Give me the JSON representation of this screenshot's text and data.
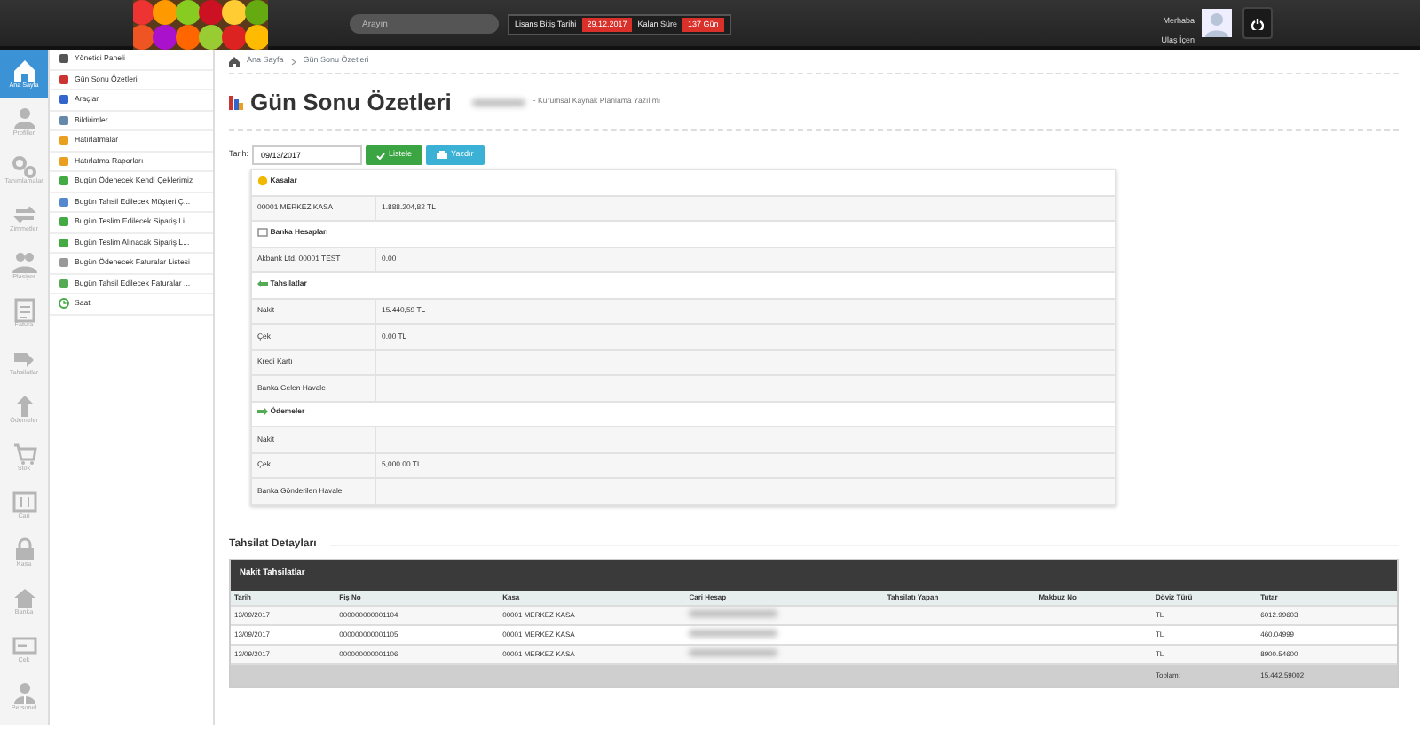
{
  "topbar": {
    "search": {
      "placeholder": "Arayın"
    },
    "license": {
      "label": "Lisans Bitiş Tarihi",
      "date": "29.12.2017",
      "remaining_label": "Kalan Süre",
      "remaining": "137 Gün"
    },
    "user": {
      "greeting": "Merhaba",
      "name": "Ulaş İçen"
    }
  },
  "icon_nav": [
    {
      "label": "Ana Sayfa",
      "selected": true
    },
    {
      "label": "Profiller",
      "selected": false
    },
    {
      "label": "Tanımlamalar",
      "selected": false
    },
    {
      "label": "Zimmetler",
      "selected": false
    },
    {
      "label": "Plasiyer",
      "selected": false
    },
    {
      "label": "Fatura",
      "selected": false
    },
    {
      "label": "Tahsilatlar",
      "selected": false
    },
    {
      "label": "Ödemeler",
      "selected": false
    },
    {
      "label": "Stok",
      "selected": false
    },
    {
      "label": "Cari",
      "selected": false
    },
    {
      "label": "Kasa",
      "selected": false
    },
    {
      "label": "Banka",
      "selected": false
    },
    {
      "label": "Çek",
      "selected": false
    },
    {
      "label": "Personel",
      "selected": false
    }
  ],
  "menu": [
    {
      "label": "Yönetici Paneli"
    },
    {
      "label": "Gün Sonu Özetleri"
    },
    {
      "label": "Araçlar"
    },
    {
      "label": "Bildirimler"
    },
    {
      "label": "Hatırlatmalar"
    },
    {
      "label": "Hatırlatma Raporları"
    },
    {
      "label": "Bugün Ödenecek Kendi Çeklerimiz"
    },
    {
      "label": "Bugün Tahsil Edilecek Müşteri Ç..."
    },
    {
      "label": "Bugün Teslim Edilecek Sipariş Li..."
    },
    {
      "label": "Bugün Teslim Alınacak Sipariş L..."
    },
    {
      "label": "Bugün Ödenecek Faturalar Listesi"
    },
    {
      "label": "Bugün Tahsil Edilecek Faturalar ..."
    },
    {
      "label": "Saat"
    }
  ],
  "breadcrumb": [
    "Ana Sayfa",
    "Gün Sonu Özetleri"
  ],
  "page_title": "Gün Sonu Özetleri",
  "subtitle": "- Kurumsal Kaynak Planlama Yazılımı",
  "filter": {
    "label": "Tarih:",
    "value": "09/13/2017",
    "buttons": [
      "Listele",
      "Yazdır"
    ]
  },
  "summary": [
    {
      "title": "Kasalar",
      "rows": [
        {
          "label": "00001 MERKEZ KASA",
          "value": "1.888.204,82 TL"
        }
      ]
    },
    {
      "title": "Banka Hesapları",
      "rows": [
        {
          "label": "Akbank Ltd. 00001 TEST",
          "value": "0.00"
        }
      ]
    },
    {
      "title": "Tahsilatlar",
      "rows": [
        {
          "label": "Nakit",
          "value": "15.440,59 TL"
        },
        {
          "label": "Çek",
          "value": "0.00 TL"
        },
        {
          "label": "Kredi Kartı"
        },
        {
          "label": "Banka Gelen Havale"
        }
      ]
    },
    {
      "title": "Ödemeler",
      "rows": [
        {
          "label": "Nakit"
        },
        {
          "label": "Çek",
          "value": "5,000.00 TL"
        },
        {
          "label": "Banka Gönderilen Havale"
        }
      ]
    }
  ],
  "details": {
    "title": "Tahsilat Detayları",
    "panel_title": "Nakit Tahsilatlar",
    "columns": [
      "Tarih",
      "Fiş No",
      "Kasa",
      "Cari Hesap",
      "Tahsilatı Yapan",
      "Makbuz No",
      "Döviz Türü",
      "Tutar"
    ],
    "rows": [
      {
        "date": "13/09/2017",
        "receipt_no": "000000000001104",
        "cash_box": "00001 MERKEZ KASA",
        "currency": "TL",
        "amount": "6012.99603"
      },
      {
        "date": "13/09/2017",
        "receipt_no": "000000000001105",
        "cash_box": "00001 MERKEZ KASA",
        "currency": "TL",
        "amount": "460.04999"
      },
      {
        "date": "13/09/2017",
        "receipt_no": "000000000001106",
        "cash_box": "00001 MERKEZ KASA",
        "currency": "TL",
        "amount": "8900.54600"
      }
    ],
    "total_label": "Toplam:",
    "total": "15.442,59002"
  }
}
